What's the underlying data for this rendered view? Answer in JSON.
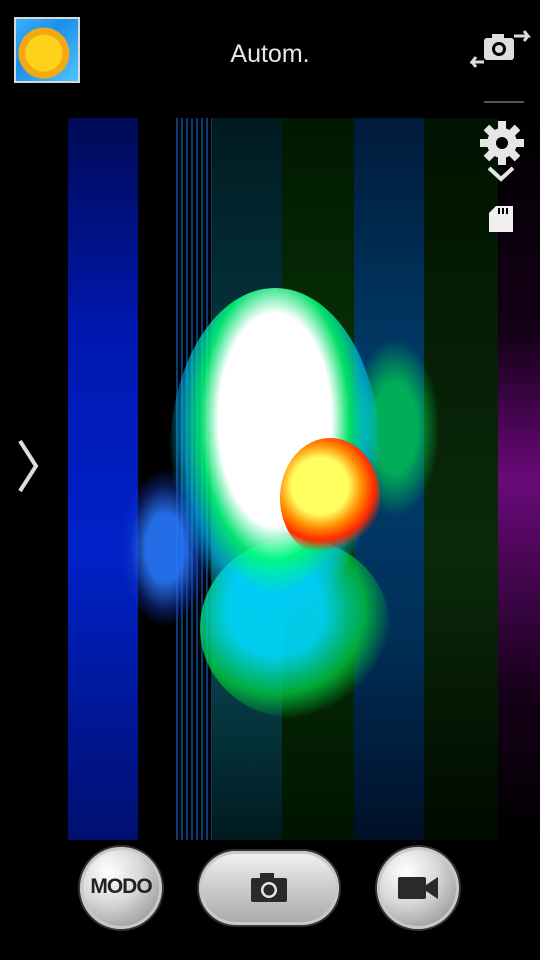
{
  "header": {
    "mode_title": "Autom."
  },
  "controls": {
    "mode_button_label": "MODO"
  },
  "colors": {
    "background": "#000000",
    "text": "#e8e8e8",
    "button_silver": "#cfcfcf"
  },
  "icons": {
    "gallery": "gallery-thumbnail",
    "switch_camera": "switch-camera-icon",
    "settings": "gear-icon",
    "expand": "chevron-down-icon",
    "storage": "sd-card-icon",
    "side_panel": "chevron-right-icon",
    "shutter": "camera-icon",
    "video": "video-camera-icon"
  }
}
